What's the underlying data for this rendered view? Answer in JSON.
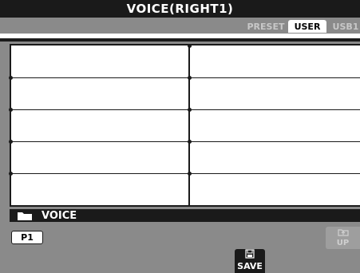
{
  "title": "VOICE(RIGHT1)",
  "tabs": [
    {
      "label": "PRESET",
      "active": false
    },
    {
      "label": "USER",
      "active": true
    },
    {
      "label": "USB1",
      "active": false
    }
  ],
  "file_list": {
    "rows": 5,
    "columns": 2,
    "items": []
  },
  "path": {
    "icon": "folder-icon",
    "label": "VOICE"
  },
  "page_button": "P1",
  "up_button": {
    "icon": "folder-up-icon",
    "label": "UP"
  },
  "save_button": {
    "icon": "floppy-disk-icon",
    "label": "SAVE"
  },
  "colors": {
    "screen_bg": "#8a8a8a",
    "dark": "#1a1a1a",
    "light": "#ffffff"
  }
}
